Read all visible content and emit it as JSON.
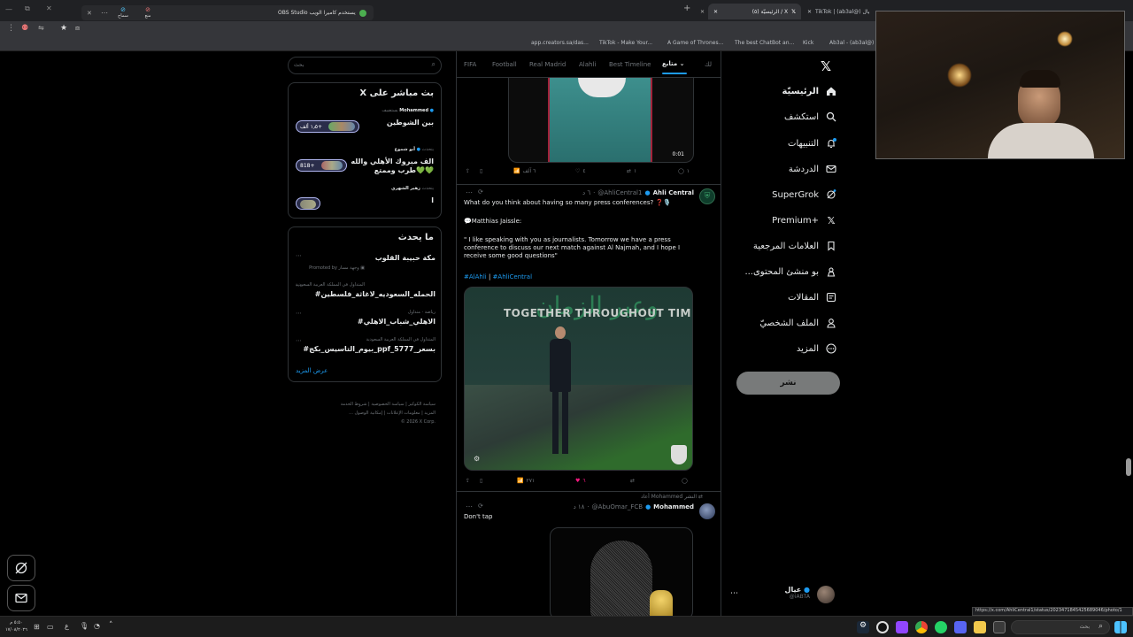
{
  "browser": {
    "tabs": [
      {
        "label": "TikTok | (ab3al@) عيال"
      },
      {
        "label": "(٥) الرئيسيّة / X"
      },
      {
        "label": "OBS Studio يستخدم كاميرا الويب"
      }
    ],
    "obs_bar": {
      "stop_label": "منع",
      "allow_label": "سماح",
      "text": "OBS Studio يستخدم كاميرا الويب"
    },
    "bookmarks": [
      "app.creators.sa/das...",
      "TikTok - Make Your...",
      "A Game of Thrones...",
      "The best ChatBot an...",
      "Kick",
      "Ab3al - (ab3al@) | ..."
    ],
    "status_url": "https://x.com/AhliCentral1/status/2023471845425689046/photo/1"
  },
  "nav": {
    "items": [
      {
        "label": "الرئيسيّة",
        "icon": "home-icon"
      },
      {
        "label": "استكشف",
        "icon": "search-icon"
      },
      {
        "label": "التنبيهات",
        "icon": "bell-icon"
      },
      {
        "label": "الدردشة",
        "icon": "mail-icon"
      },
      {
        "label": "SuperGrok",
        "icon": "grok-icon"
      },
      {
        "label": "Premium+",
        "icon": "x-logo-icon"
      },
      {
        "label": "العلامات المرجعية",
        "icon": "bookmark-icon"
      },
      {
        "label": "...بو منشئ المحتوى",
        "icon": "creator-icon"
      },
      {
        "label": "المقالات",
        "icon": "article-icon"
      },
      {
        "label": "الملف الشخصيّ",
        "icon": "person-icon"
      },
      {
        "label": "المزيد",
        "icon": "more-icon"
      }
    ],
    "post_button": "نشر",
    "account": {
      "name": "عيال",
      "handle": "@iABTA"
    }
  },
  "feed": {
    "tabs": [
      "FIFA",
      "Football",
      "Real Madrid",
      "Alahli",
      "Best Timeline",
      "متابع",
      "لك"
    ],
    "active_tab": "متابع",
    "top_video": {
      "duration": "0:01",
      "views": "٦ آلف",
      "likes": "٤",
      "retweets": "١",
      "replies": "١"
    },
    "tweet1": {
      "author": "Ahli Central",
      "handle": "@AhliCentral1",
      "time": "٦ د",
      "line1": "What do you think about having so many press conferences? ❓🎙️",
      "line2": "💬Matthias Jaissle:",
      "quote": "\" I like speaking with you as journalists. Tomorrow we have a press conference to discuss our next match against Al Najmah, and I hope I receive some good questions\"",
      "hashtags": [
        "#AlAhli",
        "|",
        "#AhliCentral"
      ],
      "image_text": "TOGETHER THROUGHOUT TIME",
      "views": "٢٧١",
      "likes": "٦"
    },
    "tweet2": {
      "retweeted_by": "أعاد Mohammed النشر",
      "author": "Mohammed",
      "handle": "@AbuOmar_FCB",
      "time": "١٨ د",
      "text": "Don't tap"
    }
  },
  "sidebar": {
    "search_placeholder": "بحث",
    "live": {
      "title": "X بث مباشر على",
      "items": [
        {
          "meta": "يستضيف",
          "host": "Mohammed",
          "title": "بين الشوطين",
          "count": "١٫٥ ألف+"
        },
        {
          "meta": "يتحدث",
          "host": "أبو شموع",
          "title": "الف مبروك الأهلي والله طرب وممتع💚💚",
          "count": "818+"
        },
        {
          "meta": "يتحدث",
          "host": "زهير الشهري",
          "title": "ا",
          "count": ""
        }
      ]
    },
    "trends": {
      "title": "ما يحدث",
      "items": [
        {
          "meta": "",
          "title": "مكة حبيبة القلوب",
          "sub": "Promoted by وجهة مسار"
        },
        {
          "meta": "المتداول في المملكة العربية السعودية",
          "title": "#الحمله_السعوديه_لاغاثة_فلسطين",
          "sub": ""
        },
        {
          "meta": "رياضة · متداول",
          "title": "#الاهلي_شباب_الاهلي",
          "sub": ""
        },
        {
          "meta": "المتداول في المملكة العربية السعودية",
          "title": "#بيوم_التاسيس_بكج_ppf_بسعر_5777",
          "sub": ""
        }
      ],
      "show_more": "عرض المزيد"
    },
    "footer": {
      "row1": [
        "شروط الخدمة",
        "سياسة الخصوصية",
        "سياسة الكوكيز"
      ],
      "row2": [
        "إمكانية الوصول",
        "معلومات الإعلانات",
        "... المزيد"
      ],
      "copyright": "© 2026 X Corp."
    }
  },
  "taskbar": {
    "search_placeholder": "بحث",
    "clock_time": "٥:٥٠ م",
    "clock_date": "١٧/٠٨/٢٠٢٦",
    "lang": "ع"
  },
  "colors": {
    "accent": "#1d9bf0",
    "like": "#f91880",
    "bg": "#000000",
    "border": "#2f3336"
  }
}
